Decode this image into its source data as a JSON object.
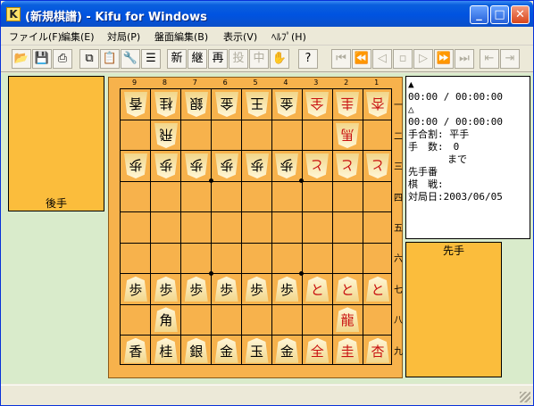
{
  "window": {
    "title": "(新規棋譜) - Kifu for Windows",
    "app_icon": "K"
  },
  "caption_buttons": {
    "minimize": "_",
    "maximize": "□",
    "close": "✕"
  },
  "menu": [
    "ファイル(F)",
    "編集(E)",
    "対局(P)",
    "盤面編集(B)",
    "表示(V)",
    "ﾍﾙﾌﾟ(H)"
  ],
  "toolbar": [
    {
      "name": "open",
      "glyph": "📂",
      "enabled": true
    },
    {
      "name": "save",
      "glyph": "💾",
      "enabled": true
    },
    {
      "name": "print",
      "glyph": "⎙",
      "enabled": true
    },
    {
      "name": "copy",
      "glyph": "⧉",
      "enabled": true
    },
    {
      "name": "paste",
      "glyph": "📋",
      "enabled": false
    },
    {
      "name": "tools",
      "glyph": "🔧",
      "enabled": true
    },
    {
      "name": "list",
      "glyph": "☰",
      "enabled": true
    },
    {
      "name": "new",
      "glyph": "新",
      "enabled": true
    },
    {
      "name": "continue",
      "glyph": "継",
      "enabled": true
    },
    {
      "name": "replay",
      "glyph": "再",
      "enabled": true
    },
    {
      "name": "resign",
      "glyph": "投",
      "enabled": false
    },
    {
      "name": "interrupt",
      "glyph": "中",
      "enabled": false
    },
    {
      "name": "wait",
      "glyph": "✋",
      "enabled": false
    },
    {
      "name": "help",
      "glyph": "?",
      "enabled": true
    },
    {
      "name": "first",
      "glyph": "⏮",
      "enabled": false
    },
    {
      "name": "back10",
      "glyph": "⏪",
      "enabled": false
    },
    {
      "name": "back",
      "glyph": "◁",
      "enabled": false
    },
    {
      "name": "stop",
      "glyph": "▫",
      "enabled": false
    },
    {
      "name": "forward",
      "glyph": "▷",
      "enabled": false
    },
    {
      "name": "forward10",
      "glyph": "⏩",
      "enabled": false
    },
    {
      "name": "last",
      "glyph": "⏭",
      "enabled": false
    },
    {
      "name": "branch-back",
      "glyph": "⇤",
      "enabled": false
    },
    {
      "name": "branch-forward",
      "glyph": "⇥",
      "enabled": false
    }
  ],
  "board": {
    "col_numbers": [
      "9",
      "8",
      "7",
      "6",
      "5",
      "4",
      "3",
      "2",
      "1"
    ],
    "row_numbers": [
      "一",
      "二",
      "三",
      "四",
      "五",
      "六",
      "七",
      "八",
      "九"
    ],
    "pieces": [
      {
        "col": 9,
        "row": 1,
        "kanji": "香",
        "owner": "gote",
        "red": false
      },
      {
        "col": 8,
        "row": 1,
        "kanji": "桂",
        "owner": "gote",
        "red": false
      },
      {
        "col": 7,
        "row": 1,
        "kanji": "銀",
        "owner": "gote",
        "red": false
      },
      {
        "col": 6,
        "row": 1,
        "kanji": "金",
        "owner": "gote",
        "red": false
      },
      {
        "col": 5,
        "row": 1,
        "kanji": "王",
        "owner": "gote",
        "red": false
      },
      {
        "col": 4,
        "row": 1,
        "kanji": "金",
        "owner": "gote",
        "red": false
      },
      {
        "col": 3,
        "row": 1,
        "kanji": "全",
        "owner": "gote",
        "red": true
      },
      {
        "col": 2,
        "row": 1,
        "kanji": "圭",
        "owner": "gote",
        "red": true
      },
      {
        "col": 1,
        "row": 1,
        "kanji": "杏",
        "owner": "gote",
        "red": true
      },
      {
        "col": 8,
        "row": 2,
        "kanji": "飛",
        "owner": "gote",
        "red": false
      },
      {
        "col": 2,
        "row": 2,
        "kanji": "馬",
        "owner": "gote",
        "red": true
      },
      {
        "col": 9,
        "row": 3,
        "kanji": "歩",
        "owner": "gote",
        "red": false
      },
      {
        "col": 8,
        "row": 3,
        "kanji": "歩",
        "owner": "gote",
        "red": false
      },
      {
        "col": 7,
        "row": 3,
        "kanji": "歩",
        "owner": "gote",
        "red": false
      },
      {
        "col": 6,
        "row": 3,
        "kanji": "歩",
        "owner": "gote",
        "red": false
      },
      {
        "col": 5,
        "row": 3,
        "kanji": "歩",
        "owner": "gote",
        "red": false
      },
      {
        "col": 4,
        "row": 3,
        "kanji": "歩",
        "owner": "gote",
        "red": false
      },
      {
        "col": 3,
        "row": 3,
        "kanji": "と",
        "owner": "gote",
        "red": true
      },
      {
        "col": 2,
        "row": 3,
        "kanji": "と",
        "owner": "gote",
        "red": true
      },
      {
        "col": 1,
        "row": 3,
        "kanji": "と",
        "owner": "gote",
        "red": true
      },
      {
        "col": 9,
        "row": 7,
        "kanji": "歩",
        "owner": "sente",
        "red": false
      },
      {
        "col": 8,
        "row": 7,
        "kanji": "歩",
        "owner": "sente",
        "red": false
      },
      {
        "col": 7,
        "row": 7,
        "kanji": "歩",
        "owner": "sente",
        "red": false
      },
      {
        "col": 6,
        "row": 7,
        "kanji": "歩",
        "owner": "sente",
        "red": false
      },
      {
        "col": 5,
        "row": 7,
        "kanji": "歩",
        "owner": "sente",
        "red": false
      },
      {
        "col": 4,
        "row": 7,
        "kanji": "歩",
        "owner": "sente",
        "red": false
      },
      {
        "col": 3,
        "row": 7,
        "kanji": "と",
        "owner": "sente",
        "red": true
      },
      {
        "col": 2,
        "row": 7,
        "kanji": "と",
        "owner": "sente",
        "red": true
      },
      {
        "col": 1,
        "row": 7,
        "kanji": "と",
        "owner": "sente",
        "red": true
      },
      {
        "col": 8,
        "row": 8,
        "kanji": "角",
        "owner": "sente",
        "red": false
      },
      {
        "col": 2,
        "row": 8,
        "kanji": "龍",
        "owner": "sente",
        "red": true
      },
      {
        "col": 9,
        "row": 9,
        "kanji": "香",
        "owner": "sente",
        "red": false
      },
      {
        "col": 8,
        "row": 9,
        "kanji": "桂",
        "owner": "sente",
        "red": false
      },
      {
        "col": 7,
        "row": 9,
        "kanji": "銀",
        "owner": "sente",
        "red": false
      },
      {
        "col": 6,
        "row": 9,
        "kanji": "金",
        "owner": "sente",
        "red": false
      },
      {
        "col": 5,
        "row": 9,
        "kanji": "玉",
        "owner": "sente",
        "red": false
      },
      {
        "col": 4,
        "row": 9,
        "kanji": "金",
        "owner": "sente",
        "red": false
      },
      {
        "col": 3,
        "row": 9,
        "kanji": "全",
        "owner": "sente",
        "red": true
      },
      {
        "col": 2,
        "row": 9,
        "kanji": "圭",
        "owner": "sente",
        "red": true
      },
      {
        "col": 1,
        "row": 9,
        "kanji": "杏",
        "owner": "sente",
        "red": true
      }
    ]
  },
  "gote_label": "後手",
  "sente_label": "先手",
  "info": [
    "▲",
    "00:00 / 00:00:00",
    "△",
    "00:00 / 00:00:00",
    "手合割: 平手",
    "手　数:　0",
    "　　　　まで",
    "先手番",
    "棋　戦:",
    "対局日:2003/06/05"
  ],
  "colors": {
    "board": "#f7b24c",
    "stand": "#fbbd3c",
    "client": "#d9ebcb",
    "red_piece": "#c81010"
  }
}
